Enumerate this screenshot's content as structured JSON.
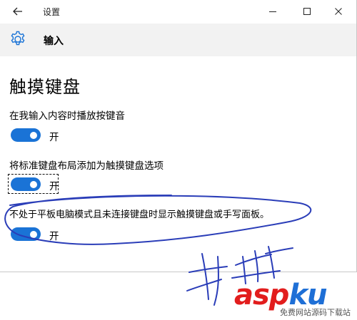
{
  "window": {
    "title": "设置",
    "back_icon": "arrow-left-icon",
    "controls": {
      "minimize": "minimize-icon",
      "maximize": "maximize-icon",
      "close": "close-icon"
    }
  },
  "header": {
    "icon": "gear-icon",
    "title": "输入"
  },
  "section": {
    "title": "触摸键盘"
  },
  "settings": [
    {
      "label": "在我输入内容时播放按键音",
      "toggle_state": "开",
      "on": true
    },
    {
      "label": "将标准键盘布局添加为触摸键盘选项",
      "toggle_state": "开",
      "on": true
    },
    {
      "label": "不处于平板电脑模式且未连接键盘时显示触摸键盘或手写面板。",
      "toggle_state": "开",
      "on": true
    }
  ],
  "colors": {
    "accent": "#1a73d6",
    "ink": "#2a3db8",
    "header_bg": "#f2f2f2"
  },
  "watermark": {
    "brand_part1": "asp",
    "brand_part2": "ku",
    "subtext": "免费网站源码下载站"
  }
}
